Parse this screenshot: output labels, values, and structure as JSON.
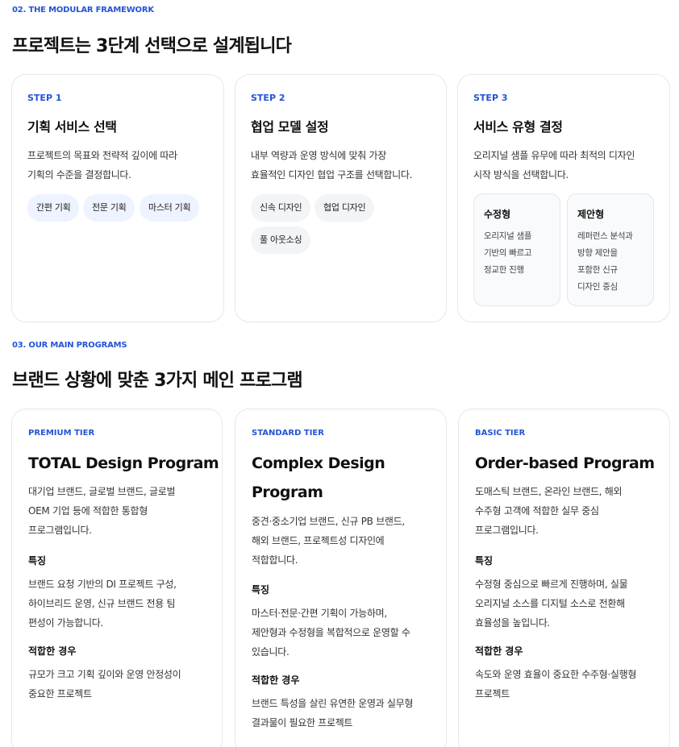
{
  "section2": {
    "eyebrow": "02. THE MODULAR FRAMEWORK",
    "title": "프로젝트는 3단계 선택으로 설계됩니다",
    "steps": [
      {
        "label": "STEP 1",
        "title": "기획 서비스 선택",
        "desc": "프로젝트의 목표와 전략적 깊이에 따라\n기획의 수준을 결정합니다.",
        "options": [
          "간편 기획",
          "전문 기획",
          "마스터 기획"
        ]
      },
      {
        "label": "STEP 2",
        "title": "협업 모델 설정",
        "desc": "내부 역량과 운영 방식에 맞춰 가장\n효율적인 디자인 협업 구조를 선택합니다.",
        "options": [
          "신속 디자인",
          "협업 디자인",
          "풀 아웃소싱"
        ]
      },
      {
        "label": "STEP 3",
        "title": "서비스 유형 결정",
        "desc": "오리지널 샘플 유무에 따라 최적의 디자인\n시작 방식을 선택합니다.",
        "types": [
          {
            "title": "수정형",
            "desc": "오리지널 샘플\n기반의 빠르고\n정교한 진행"
          },
          {
            "title": "제안형",
            "desc": "레퍼런스 분석과\n방향 제안을\n포함한 신규\n디자인 중심"
          }
        ]
      }
    ]
  },
  "section3": {
    "eyebrow": "03. OUR MAIN PROGRAMS",
    "title": "브랜드 상황에 맞춘 3가지 메인 프로그램",
    "programs": [
      {
        "tier": "PREMIUM TIER",
        "title": "TOTAL Design Program",
        "desc": "대기업 브랜드, 글로벌 브랜드, 글로벌\nOEM 기업 등에 적합한 통합형\n프로그램입니다.",
        "feature_label": "특징",
        "feature": "브랜드 요청 기반의 DI 프로젝트 구성,\n하이브리드 운영, 신규 브랜드 전용 팀\n편성이 가능합니다.",
        "fit_label": "적합한 경우",
        "fit": "규모가 크고 기획 깊이와 운영 안정성이\n중요한 프로젝트"
      },
      {
        "tier": "STANDARD TIER",
        "title": "Complex Design\nProgram",
        "desc": "중견·중소기업 브랜드, 신규 PB 브랜드,\n해외 브랜드, 프로젝트성 디자인에\n적합합니다.",
        "feature_label": "특징",
        "feature": "마스터·전문·간편 기획이 가능하며,\n제안형과 수정형을 복합적으로 운영할 수\n있습니다.",
        "fit_label": "적합한 경우",
        "fit": "브랜드 특성을 살린 유연한 운영과 실무형\n결과물이 필요한 프로젝트"
      },
      {
        "tier": "BASIC TIER",
        "title": "Order-based Program",
        "desc": "도매스틱 브랜드, 온라인 브랜드, 해외\n수주형 고객에 적합한 실무 중심\n프로그램입니다.",
        "feature_label": "특징",
        "feature": "수정형 중심으로 빠르게 진행하며, 실물\n오리지널 소스를 디지털 소스로 전환해\n효율성을 높입니다.",
        "fit_label": "적합한 경우",
        "fit": "속도와 운영 효율이 중요한 수주형·실행형\n프로젝트"
      }
    ]
  }
}
